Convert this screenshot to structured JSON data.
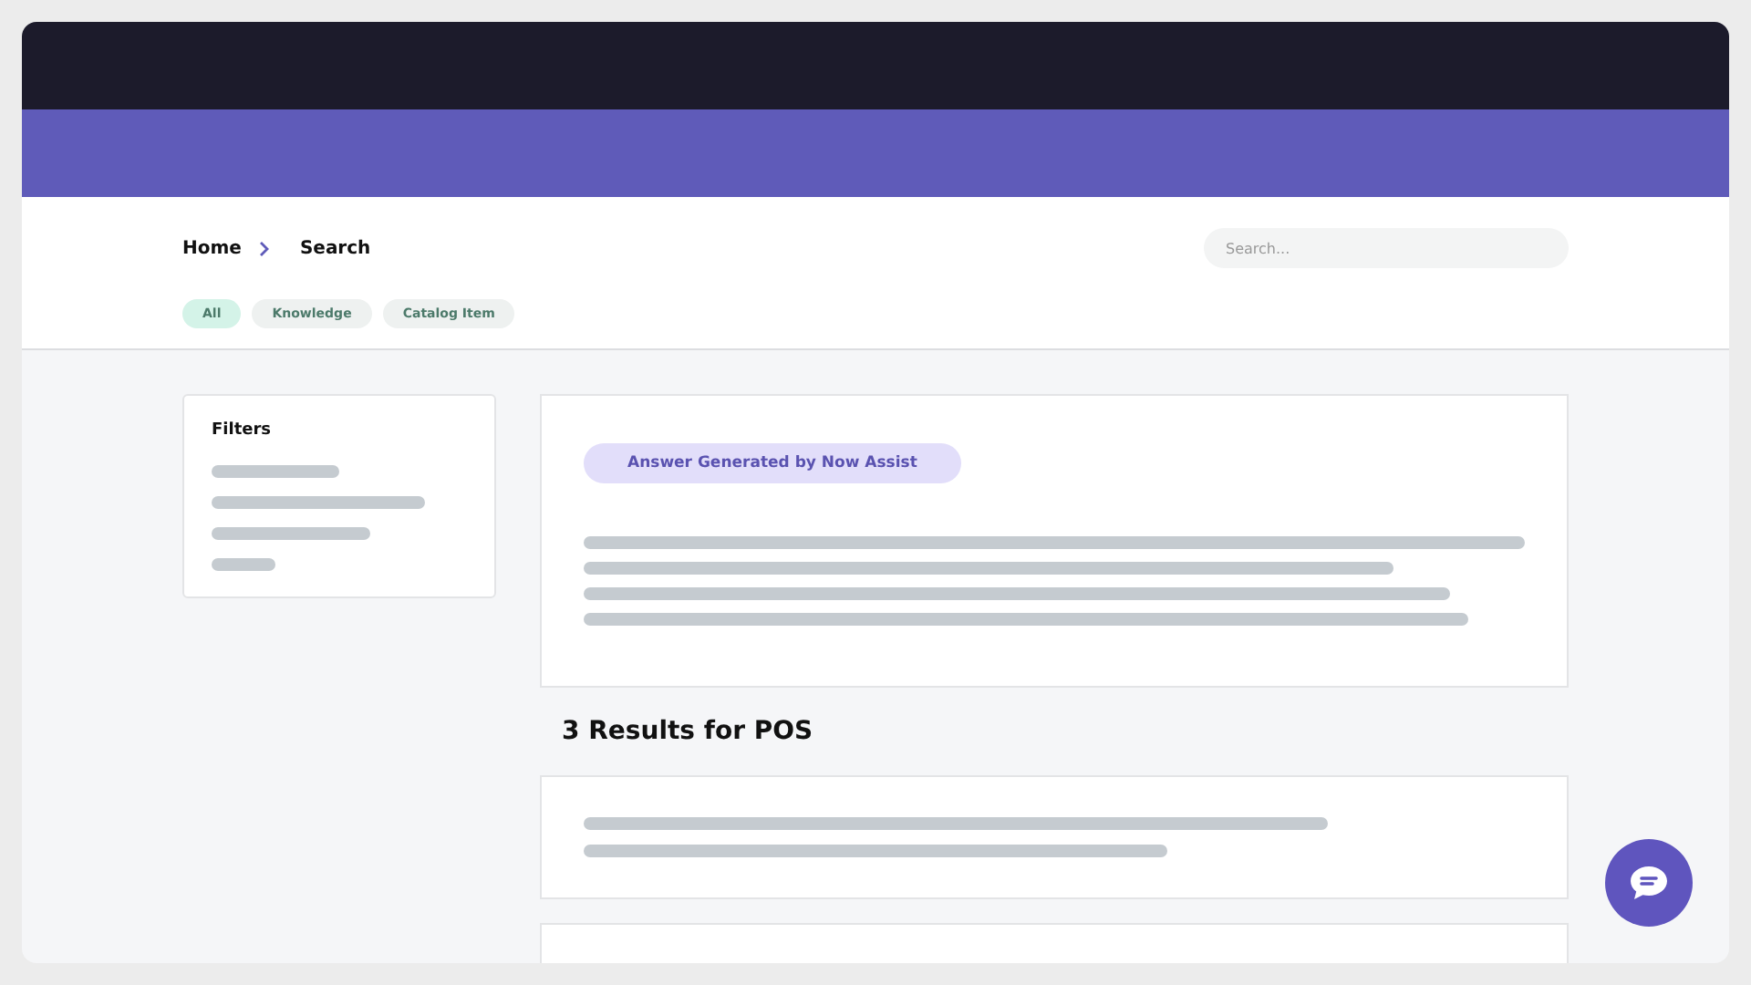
{
  "breadcrumb": [
    {
      "label": "Home"
    },
    {
      "label": "Search"
    }
  ],
  "search": {
    "placeholder": "Search..."
  },
  "filter_tabs": [
    {
      "label": "All",
      "selected": true
    },
    {
      "label": "Knowledge",
      "selected": false
    },
    {
      "label": "Catalog Item",
      "selected": false
    }
  ],
  "filters_panel": {
    "title": "Filters"
  },
  "answer_card": {
    "badge": "Answer Generated by Now Assist"
  },
  "results_heading": "3 Results for POS"
}
